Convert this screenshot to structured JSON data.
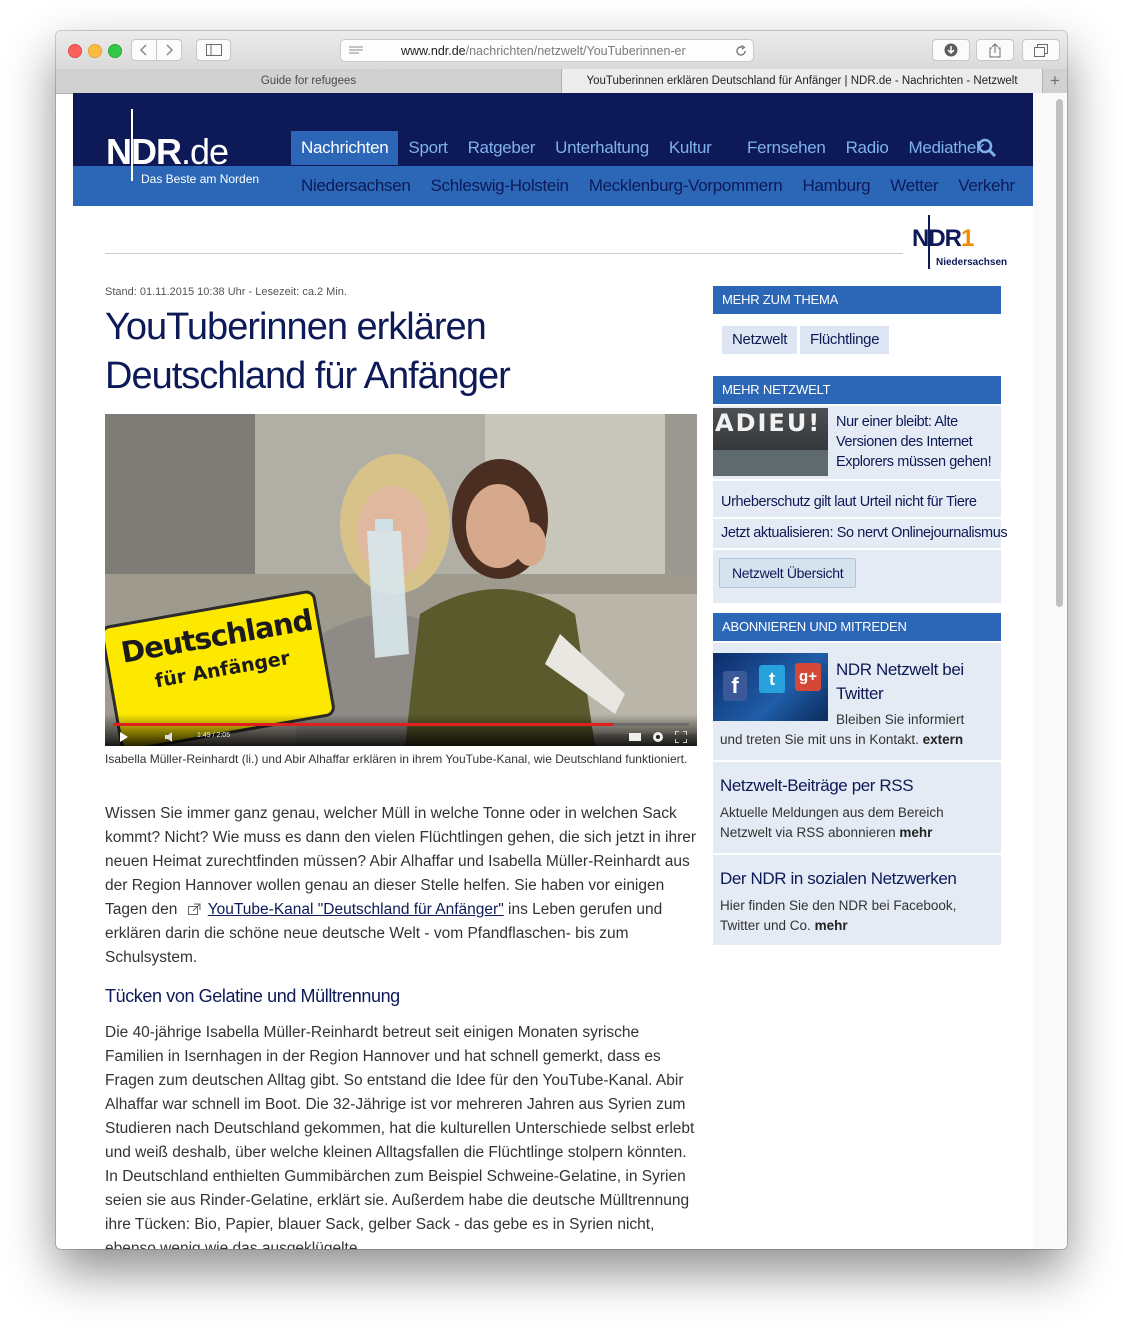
{
  "browser": {
    "url_domain": "www.ndr.de",
    "url_path": "/nachrichten/netzwelt/YouTuberinnen-er",
    "tabs": [
      {
        "label": "Guide for refugees"
      },
      {
        "label": "YouTuberinnen erklären Deutschland für Anfänger | NDR.de - Nachrichten - Netzwelt"
      }
    ],
    "new_tab_label": "+"
  },
  "header": {
    "logo": "NDR",
    "logo_suffix": ".de",
    "tagline": "Das Beste am Norden",
    "nav_left": [
      "Nachrichten",
      "Sport",
      "Ratgeber",
      "Unterhaltung",
      "Kultur"
    ],
    "nav_right": [
      "Fernsehen",
      "Radio",
      "Mediathek"
    ],
    "subnav": [
      "Niedersachsen",
      "Schleswig-Holstein",
      "Mecklenburg-Vorpommern",
      "Hamburg",
      "Wetter",
      "Verkehr"
    ],
    "ndr1_logo": "NDR",
    "ndr1_number": "1",
    "ndr1_region": "Niedersachsen"
  },
  "article": {
    "meta": "Stand: 01.11.2015 10:38 Uhr - Lesezeit: ca.2 Min.",
    "title": "YouTuberinnen erklären Deutschland für Anfänger",
    "image_sign_line1": "Deutschland",
    "image_sign_line2": "für Anfänger",
    "video_time": "1:49 / 2:05",
    "video_progress": 0.87,
    "caption": "Isabella Müller-Reinhardt (li.) und Abir Alhaffar erklären in ihrem YouTube-Kanal, wie Deutschland funktioniert.",
    "p1_before": "Wissen Sie immer ganz genau, welcher Müll in welche Tonne oder in welchen Sack kommt? Nicht? Wie muss es dann den vielen Flüchtlingen gehen, die sich jetzt in ihrer neuen Heimat zurechtfinden müssen? Abir Alhaffar und Isabella Müller-Reinhardt aus der Region Hannover wollen genau an dieser Stelle helfen. Sie haben vor einigen Tagen den ",
    "p1_link": "YouTube-Kanal \"Deutschland für Anfänger\"",
    "p1_after": " ins Leben gerufen und erklären darin die schöne neue deutsche Welt - vom Pfandflaschen- bis zum Schulsystem.",
    "subheading": "Tücken von Gelatine und Mülltrennung",
    "p2": "Die 40-jährige Isabella Müller-Reinhardt betreut seit einigen Monaten syrische Familien in Isernhagen in der Region Hannover und hat schnell gemerkt, dass es Fragen zum deutschen Alltag gibt. So entstand die Idee für den YouTube-Kanal. Abir Alhaffar war schnell im Boot. Die 32-Jährige ist vor mehreren Jahren aus Syrien zum Studieren nach Deutschland gekommen, hat die kulturellen Unterschiede selbst erlebt und weiß deshalb, über welche kleinen Alltagsfallen die Flüchtlinge stolpern könnten. In Deutschland enthielten Gummibärchen zum Beispiel Schweine-Gelatine, in Syrien seien sie aus Rinder-Gelatine, erklärt sie. Außerdem habe die deutsche Mülltrennung ihre Tücken: Bio, Papier, blauer Sack, gelber Sack - das gebe es in Syrien nicht, ebenso wenig wie das ausgeklügelte"
  },
  "sidebar": {
    "mehr_zum_thema": "MEHR ZUM THEMA",
    "tags": [
      "Netzwelt",
      "Flüchtlinge"
    ],
    "mehr_netzwelt": "MEHR NETZWELT",
    "teaser_image_text": "ADIEU!",
    "teaser_title": "Nur einer bleibt: Alte Versionen des Internet Explorers müssen gehen!",
    "links": [
      "Urheberschutz gilt laut Urteil nicht für Tiere",
      "Jetzt aktualisieren: So nervt Onlinejournalismus"
    ],
    "uebersicht_button": "Netzwelt Übersicht",
    "abonnieren": "ABONNIEREN UND MITREDEN",
    "twitter_title": "NDR Netzwelt bei Twitter",
    "twitter_text": "Bleiben Sie informiert und treten Sie mit uns in Kontakt.",
    "twitter_more": "extern",
    "rss_title": "Netzwelt-Beiträge per RSS",
    "rss_text": "Aktuelle Meldungen aus dem Bereich Netzwelt via RSS abonnieren",
    "rss_more": "mehr",
    "social_title": "Der NDR in sozialen Netzwerken",
    "social_text": "Hier finden Sie den NDR bei Facebook, Twitter und Co.",
    "social_more": "mehr",
    "social_icon_labels": [
      "f",
      "t",
      "g+"
    ]
  },
  "colors": {
    "ndr_dark_blue": "#0d1a57",
    "ndr_blue": "#2b67b6",
    "nav_link": "#7fb2ec",
    "sidebar_bg": "#e4ebf4",
    "ndr1_orange": "#f08a00"
  },
  "icons": [
    "back-chevron-icon",
    "forward-chevron-icon",
    "sidebar-icon",
    "reader-icon",
    "reload-icon",
    "download-icon",
    "share-icon",
    "tabs-icon",
    "search-icon",
    "external-link-icon",
    "play-icon",
    "volume-icon",
    "settings-icon",
    "fullscreen-icon"
  ]
}
